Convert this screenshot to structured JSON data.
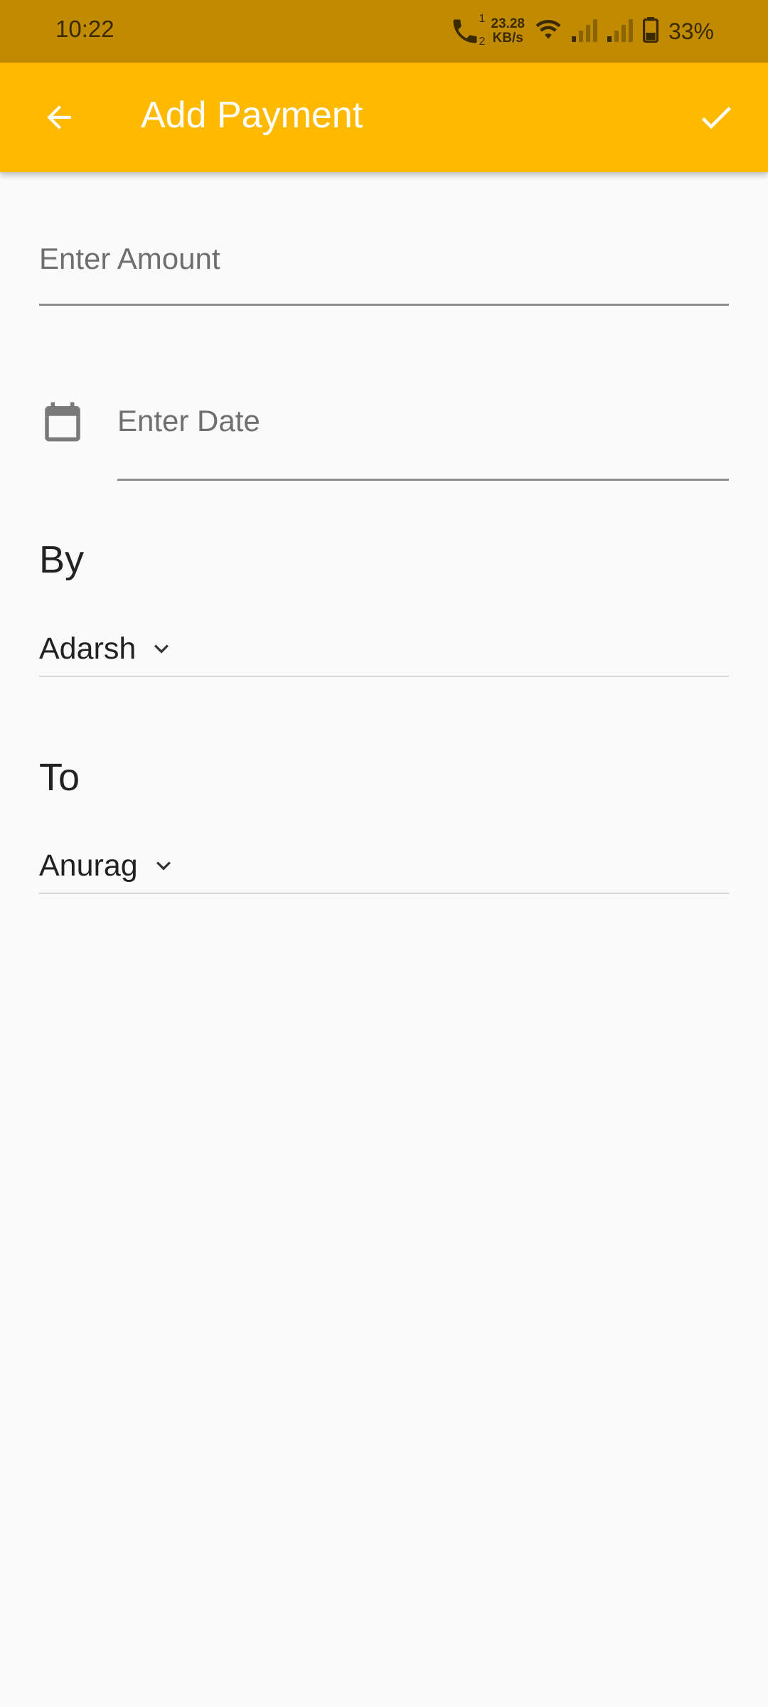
{
  "status_bar": {
    "time": "10:22",
    "net_speed_value": "23.28",
    "net_speed_unit": "KB/s",
    "battery": "33%",
    "sim_labels": [
      "1",
      "2"
    ]
  },
  "app_bar": {
    "title": "Add Payment",
    "color": "#ffb900"
  },
  "form": {
    "amount_placeholder": "Enter Amount",
    "date_placeholder": "Enter Date",
    "by_label": "By",
    "by_value": "Adarsh",
    "to_label": "To",
    "to_value": "Anurag"
  }
}
